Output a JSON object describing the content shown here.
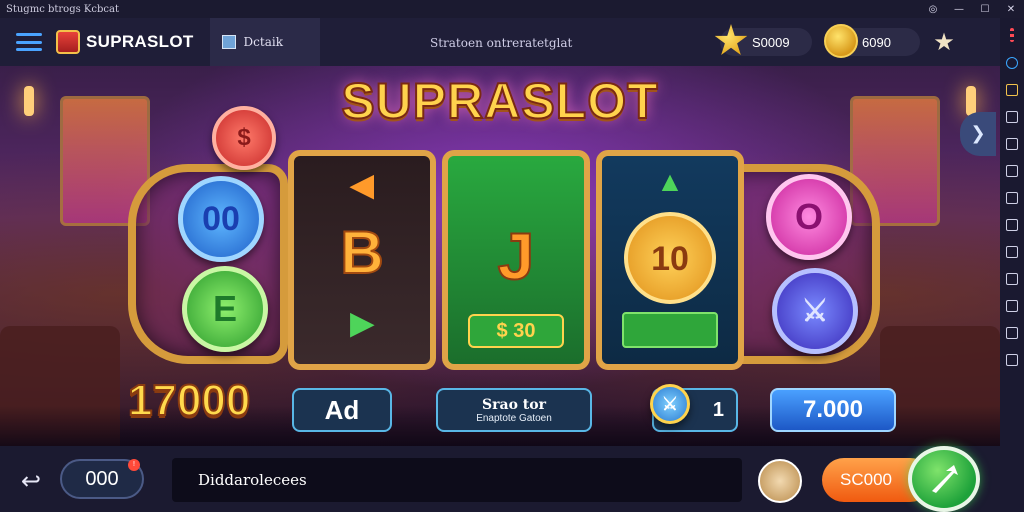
{
  "window": {
    "title": "Stugmc btrogs  Kcbcat",
    "controls": [
      "◎",
      "—",
      "☐",
      "✕"
    ]
  },
  "toolbar": {
    "app_name": "SUPRASLOT",
    "tab_label": "Dctaik",
    "subtitle": "Stratoen ontreratetglat",
    "stars_value": "S0009",
    "coins_value": "6090"
  },
  "game": {
    "title": "SUPRASLOT",
    "win_amount": "17000",
    "reels": [
      {
        "top": "◀",
        "middle": "B",
        "bottom": "▶"
      },
      {
        "top": "",
        "middle": "J",
        "bottom": "$ 30"
      },
      {
        "top": "▲",
        "middle": "10",
        "bottom": ""
      }
    ],
    "left_chips": [
      "00",
      "E"
    ],
    "right_chips": [
      "O",
      "⚔"
    ],
    "ad_label": "Ad",
    "status_line1": "Srao tor",
    "status_line2": "Enaptote Gatoen",
    "count_value": "1",
    "balance_value": "7.000"
  },
  "bottom": {
    "counter_value": "000",
    "counter_badge": "!",
    "input_value": "Diddarolecees",
    "bet_label": "SC000"
  },
  "colors": {
    "accent": "#3aa7ff",
    "gold": "#ffd34d",
    "spin": "#1ea23a",
    "bet": "#f05a10"
  },
  "icons": [
    "menu-icon",
    "app-logo-icon",
    "star-icon",
    "coin-icon",
    "favorite-star-icon",
    "back-icon",
    "spin-arrow-icon",
    "chevron-right-icon"
  ]
}
